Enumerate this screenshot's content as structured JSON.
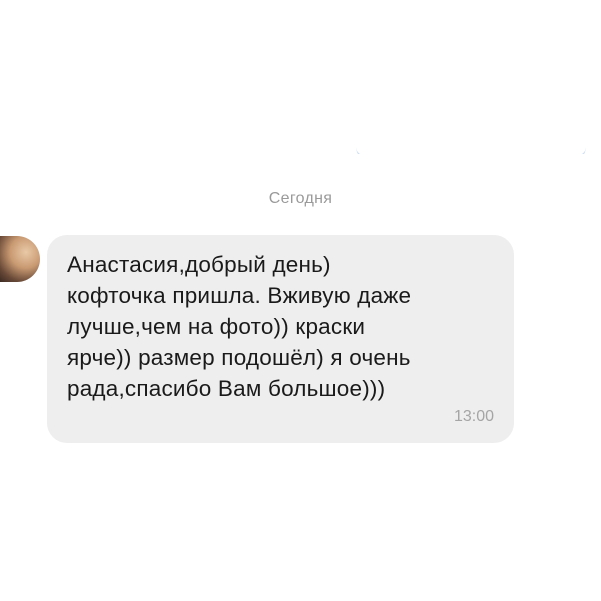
{
  "colors": {
    "background": "#ffffff",
    "bubble_received": "#eeeeee",
    "bubble_sent_edge": "#cfe0f4",
    "date_text": "#9a9a9a",
    "time_text": "#a5a5a5",
    "message_text": "#1a1a1a"
  },
  "chat": {
    "date_separator": "Сегодня",
    "messages": [
      {
        "direction": "incoming",
        "text": "Анастасия,добрый день)\nкофточка пришла. Вживую даже\nлучше,чем на фото)) краски\nярче)) размер подошёл) я очень\nрада,спасибо Вам большое)))",
        "time": "13:00",
        "avatar_icon": "user-avatar-icon"
      }
    ]
  }
}
